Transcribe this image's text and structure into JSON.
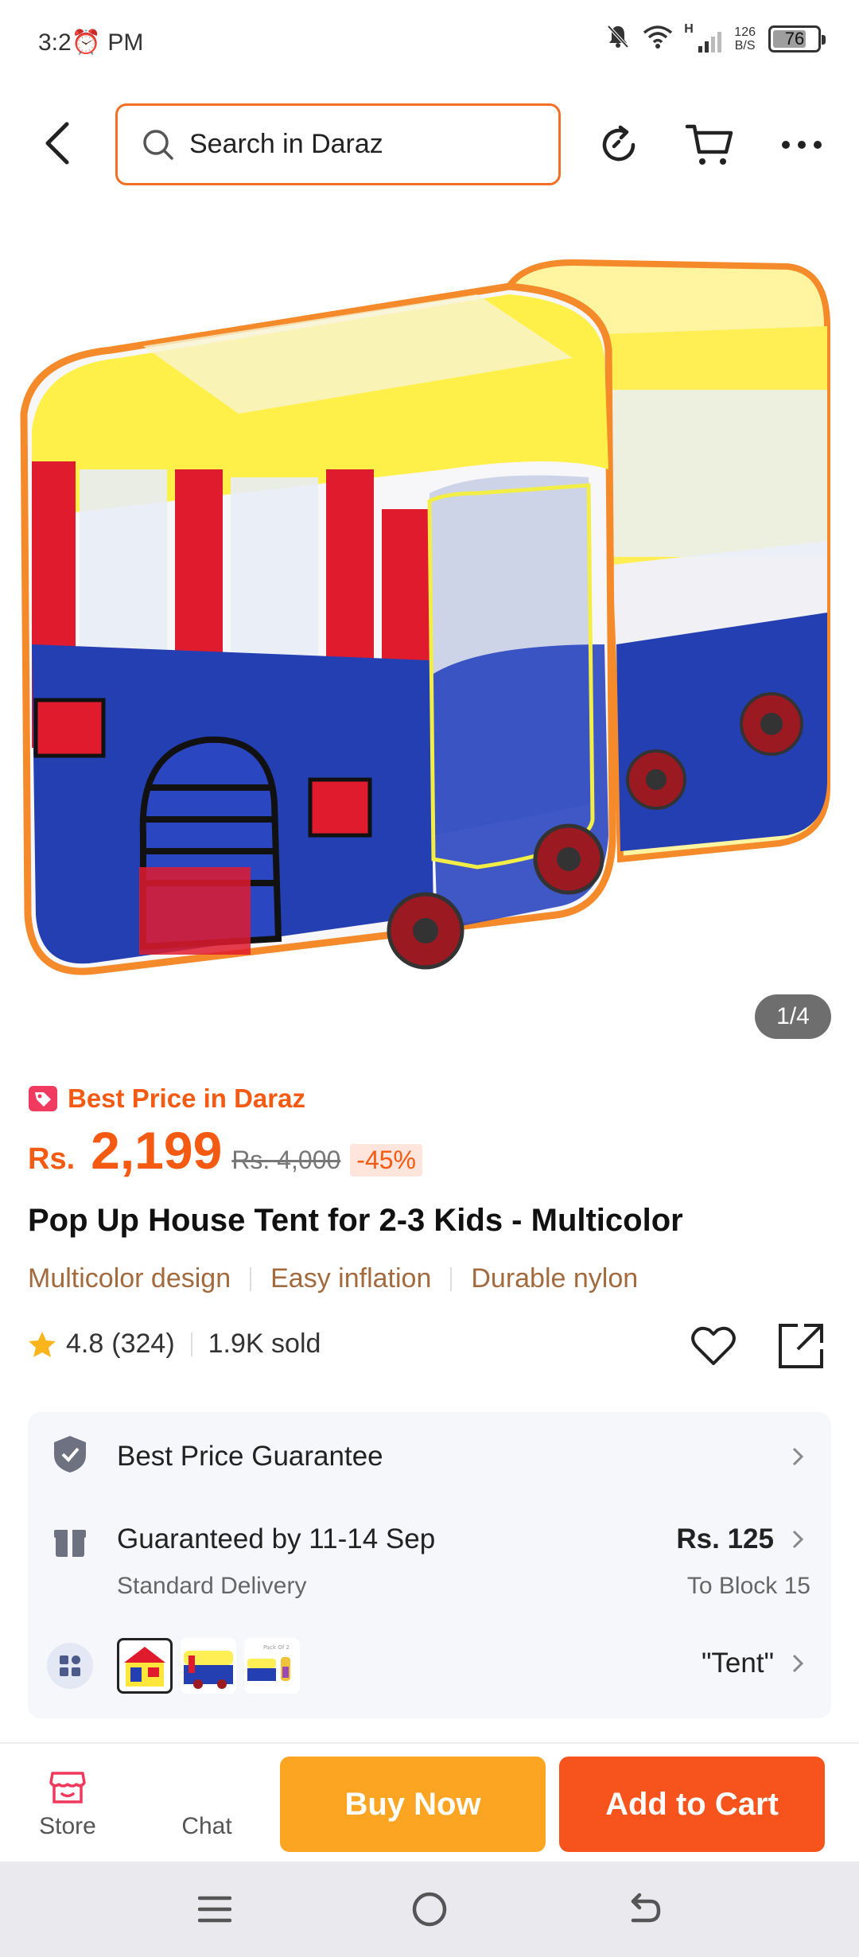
{
  "status_bar": {
    "time": "3:2⏰ PM",
    "network_type": "H",
    "net_speed_value": "126",
    "net_speed_unit": "B/S",
    "battery": "76",
    "battery_level": 0.76
  },
  "top_bar": {
    "search_placeholder": "Search in Daraz",
    "icons": [
      "back-arrow-icon",
      "search-icon",
      "refresh-icon",
      "cart-icon",
      "more-icon"
    ]
  },
  "product": {
    "image_counter": "1/4",
    "best_price_label": "Best Price in Daraz",
    "currency": "Rs.",
    "price": "2,199",
    "old_price": "Rs. 4,000",
    "discount": "-45%",
    "title": "Pop Up House Tent for 2-3 Kids - Multicolor",
    "features": [
      "Multicolor design",
      "Easy inflation",
      "Durable nylon"
    ],
    "rating": "4.8",
    "rating_count": "(324)",
    "sold": "1.9K sold"
  },
  "info_card": {
    "guarantee": "Best Price Guarantee",
    "delivery_title": "Guaranteed by 11-14 Sep",
    "delivery_type": "Standard Delivery",
    "delivery_fee": "Rs. 125",
    "delivery_location": "To Block 15",
    "variant_label": "\"Tent\""
  },
  "action_bar": {
    "store_label": "Store",
    "chat_label": "Chat",
    "buy_now_label": "Buy Now",
    "add_to_cart_label": "Add to Cart"
  },
  "colors": {
    "brand_orange": "#f55a13",
    "buy_now": "#fca523",
    "add_to_cart": "#f6541c",
    "search_border": "#f36f24"
  }
}
